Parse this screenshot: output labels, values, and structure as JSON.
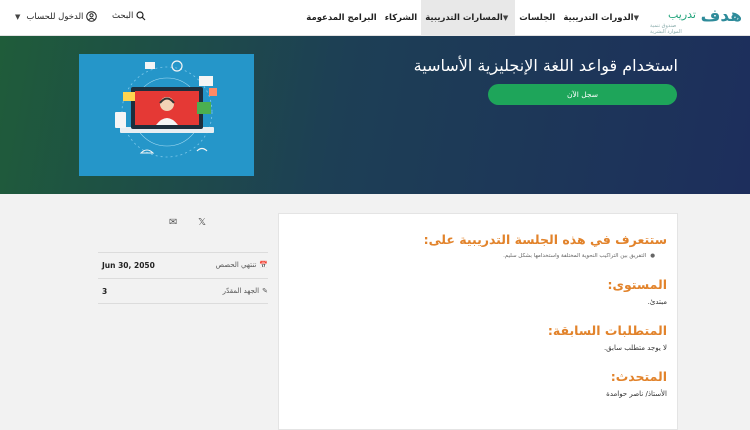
{
  "brand": {
    "name": "هدف",
    "sub": "تدريب",
    "tagline": "صندوق تنمية الموارد البشرية"
  },
  "nav": {
    "courses": "الدورات التدريبية",
    "sessions": "الجلسات",
    "paths": "المسارات التدريبية",
    "partners": "الشركاء",
    "programs": "البرامج المدعومة",
    "search": "البحث",
    "login": "الدخول للحساب"
  },
  "hero": {
    "title": "استخدام قواعد اللغة الإنجليزية الأساسية",
    "register": "سجل الآن"
  },
  "content": {
    "learn_title": "ستتعرف في هذه الجلسة التدريبية على:",
    "learn_items": [
      "التفريق بين التراكيب النحوية المختلفة واستخدامها بشكل سليم."
    ],
    "level_title": "المستوى:",
    "level_value": "مبتدئ.",
    "prereq_title": "المتطلبات السابقة:",
    "prereq_value": "لا يوجد متطلب سابق.",
    "speaker_title": "المتحدث:",
    "speaker_value": "الأستاذ/ ناصر حوامدة"
  },
  "sidebar": {
    "end_label": "تنتهي الحصص",
    "end_value": "Jun 30, 2050",
    "effort_label": "الجهد المقدّر",
    "effort_value": "3"
  }
}
